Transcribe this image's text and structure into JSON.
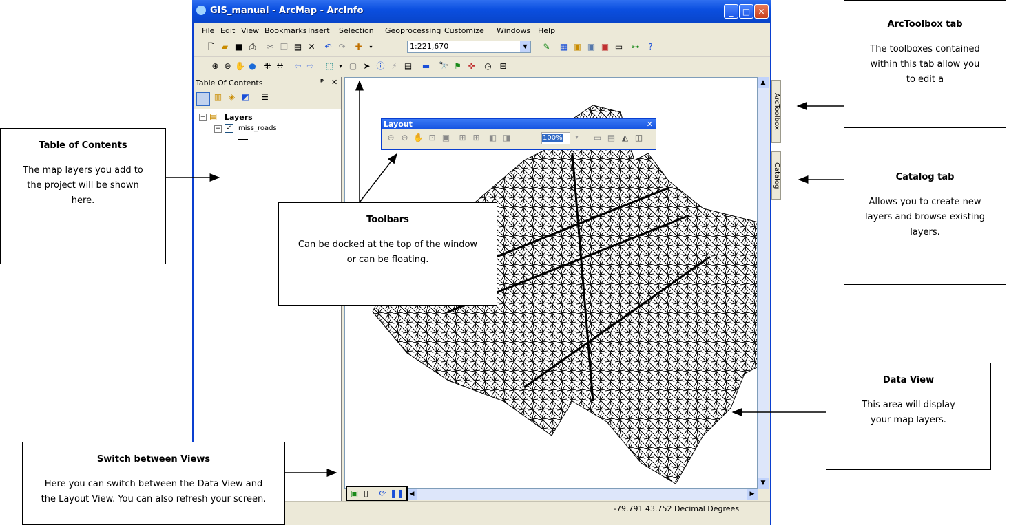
{
  "window": {
    "title": "GIS_manual - ArcMap - ArcInfo",
    "minimize": "_",
    "maximize": "□",
    "close": "✕"
  },
  "menu": [
    "File",
    "Edit",
    "View",
    "Bookmarks",
    "Insert",
    "Selection",
    "Geoprocessing",
    "Customize",
    "Windows",
    "Help"
  ],
  "toolbar": {
    "scale_value": "1:221,670"
  },
  "toc": {
    "title": "Table Of Contents",
    "pin": "ᵖ",
    "close": "✕",
    "root_label": "Layers",
    "layer_label": "miss_roads"
  },
  "layout_toolbar": {
    "title": "Layout",
    "zoom_value": "100%"
  },
  "side_tabs": {
    "arctoolbox": "ArcToolbox",
    "catalog": "Catalog"
  },
  "statusbar": {
    "coords": "-79.791  43.752 Decimal Degrees"
  },
  "callouts": {
    "toc": {
      "heading": "Table of Contents",
      "body": "The map layers you add to the project will be shown here."
    },
    "toolbars": {
      "heading": "Toolbars",
      "body": "Can be docked at the top of the window or can be floating."
    },
    "views": {
      "heading": "Switch between Views",
      "body": "Here you can switch between the Data View and the Layout View.  You can also refresh your screen."
    },
    "arctoolbox": {
      "heading": "ArcToolbox tab",
      "body": "The toolboxes contained within this tab allow you to edit a"
    },
    "catalog": {
      "heading": "Catalog tab",
      "body": "Allows you to create new layers and browse existing layers."
    },
    "dataview": {
      "heading": "Data View",
      "body": "This area will display your map layers."
    }
  }
}
